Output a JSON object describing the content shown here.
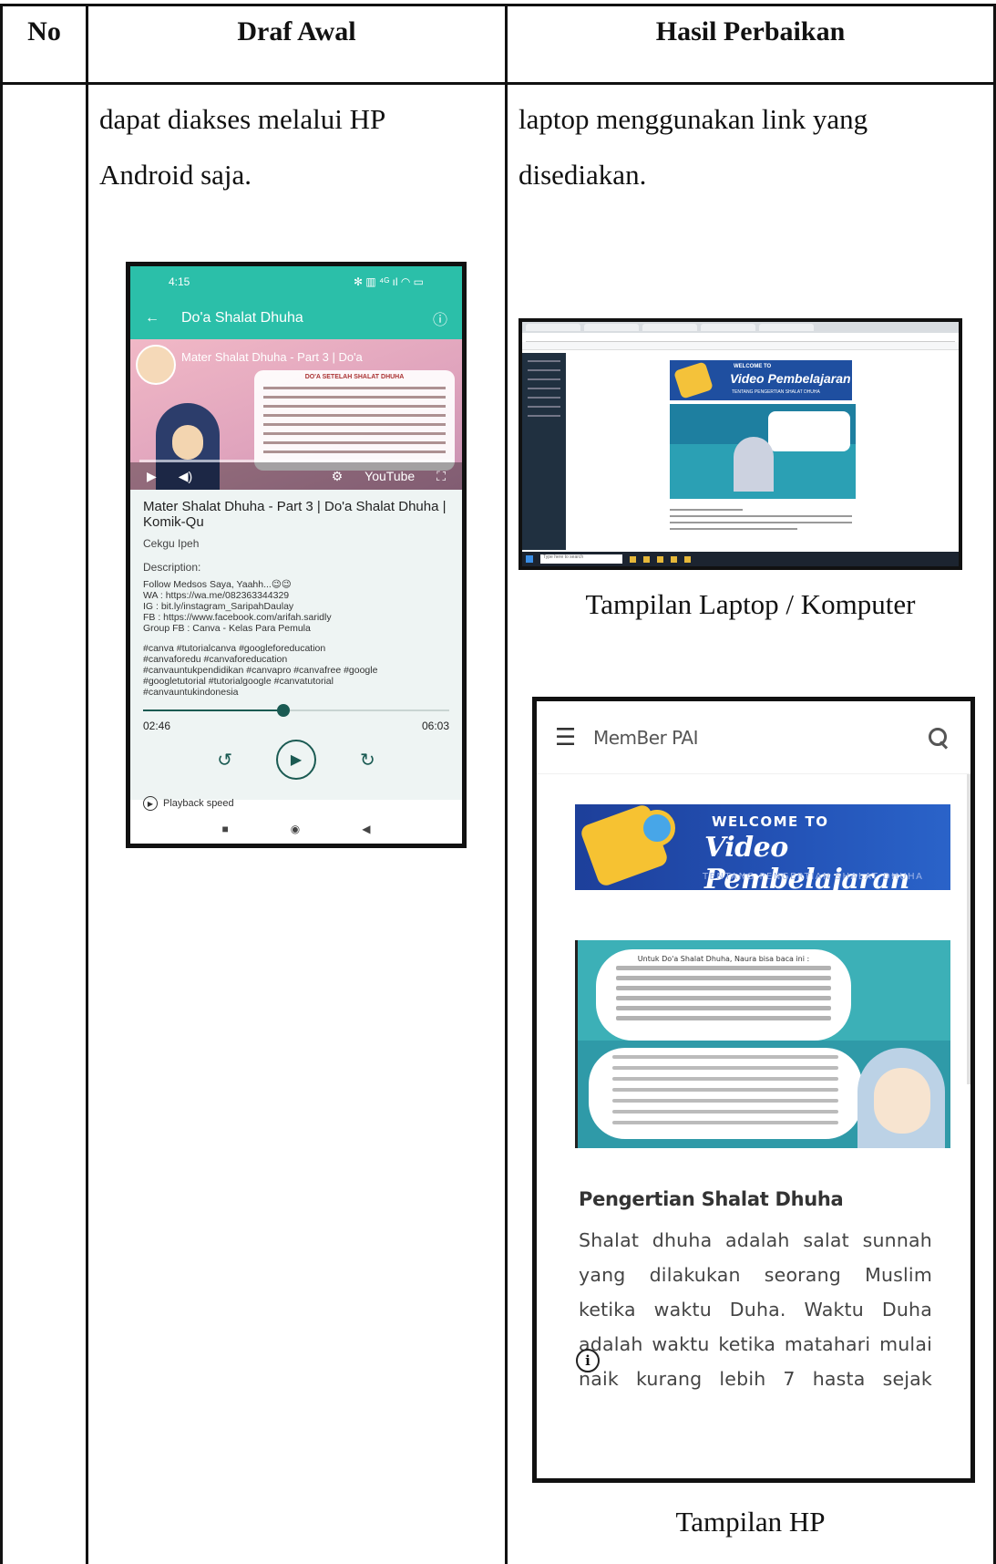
{
  "table": {
    "headers": [
      "No",
      "Draf Awal",
      "Hasil Perbaikan"
    ],
    "draf_awal_text": [
      "dapat diakses melalui HP",
      "Android saja."
    ],
    "hasil_text": [
      "laptop menggunakan link yang",
      "disediakan."
    ],
    "caption_laptop": "Tampilan Laptop / Komputer",
    "caption_hp": "Tampilan HP"
  },
  "phone": {
    "status_time": "4:15",
    "status_icons": "✻ ▥ ⁴ᴳ ıl ◠ ▭",
    "app_title": "Do'a Shalat Dhuha",
    "video_title_overlay": "Mater Shalat Dhuha - Part 3 | Do'a",
    "video_heading": "DO'A SETELAH SHALAT DHUHA",
    "video_title": "Mater Shalat Dhuha - Part 3 | Do'a Shalat Dhuha | Komik-Qu",
    "channel": "Cekgu Ipeh",
    "description_label": "Description:",
    "description": "Follow Medsos Saya, Yaahh...😉😉\nWA : https://wa.me/082363344329\nIG : bit.ly/instagram_SaripahDaulay\nFB : https://www.facebook.com/arifah.saridly\nGroup FB : Canva - Kelas Para Pemula",
    "tags": "#canva #tutorialcanva #googleforeducation\n#canvaforedu #canvaforeducation\n#canvauntukpendidikan #canvapro #canvafree #google\n#googletutorial #tutorialgoogle #canvatutorial\n#canvauntukindonesia",
    "time_current": "02:46",
    "time_total": "06:03",
    "progress_fraction": 0.459,
    "rewind_label": "↺",
    "play_label": "▶",
    "forward_label": "↻",
    "playback_speed": "Playback speed",
    "youtube_label": "YouTube"
  },
  "laptop": {
    "banner_welcome": "WELCOME TO",
    "banner_title": "Video Pembelajaran",
    "banner_sub": "TENTANG PENGERTIAN SHALAT DHUHA",
    "search_placeholder": "Type here to search"
  },
  "hp": {
    "site_name": "MemBer PAI",
    "banner_welcome": "WELCOME TO",
    "banner_title": "Video Pembelajaran",
    "banner_sub": "TENTANG PENGERTIAN SHALAT DHUHA",
    "image_caption": "Untuk Do'a Shalat Dhuha, Naura bisa baca ini :",
    "section_title": "Pengertian Shalat Dhuha",
    "paragraph_lines": [
      "Shalat dhuha adalah salat sunnah",
      "yang dilakukan seorang Muslim",
      "ketika waktu Duha. Waktu Duha",
      "adalah waktu ketika matahari mulai",
      "naik kurang lebih 7 hasta sejak"
    ],
    "info_icon": "i"
  }
}
